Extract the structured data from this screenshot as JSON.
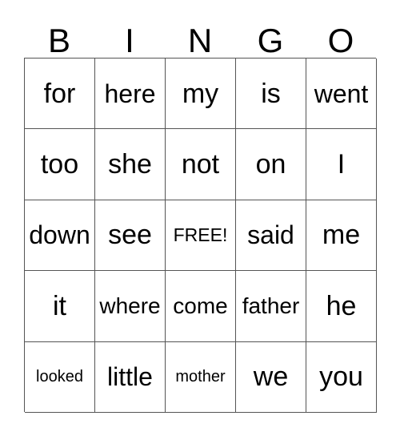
{
  "card": {
    "title_letters": [
      "B",
      "I",
      "N",
      "G",
      "O"
    ],
    "background_color": "#ffffff",
    "text_color": "#000000",
    "grid_line_color": "#555555",
    "columns": 5,
    "rows": 5,
    "free_space": "FREE!",
    "grid": [
      [
        {
          "word": "for",
          "size": "xl"
        },
        {
          "word": "here",
          "size": "lg"
        },
        {
          "word": "my",
          "size": "xl"
        },
        {
          "word": "is",
          "size": "xl"
        },
        {
          "word": "went",
          "size": "lg"
        }
      ],
      [
        {
          "word": "too",
          "size": "xl"
        },
        {
          "word": "she",
          "size": "xl"
        },
        {
          "word": "not",
          "size": "xl"
        },
        {
          "word": "on",
          "size": "xl"
        },
        {
          "word": "I",
          "size": "xl"
        }
      ],
      [
        {
          "word": "down",
          "size": "lg"
        },
        {
          "word": "see",
          "size": "xl"
        },
        {
          "word": "FREE!",
          "size": "sm"
        },
        {
          "word": "said",
          "size": "lg"
        },
        {
          "word": "me",
          "size": "xl"
        }
      ],
      [
        {
          "word": "it",
          "size": "xl"
        },
        {
          "word": "where",
          "size": "md"
        },
        {
          "word": "come",
          "size": "md"
        },
        {
          "word": "father",
          "size": "md"
        },
        {
          "word": "he",
          "size": "xl"
        }
      ],
      [
        {
          "word": "looked",
          "size": "xs"
        },
        {
          "word": "little",
          "size": "lg"
        },
        {
          "word": "mother",
          "size": "xs"
        },
        {
          "word": "we",
          "size": "xl"
        },
        {
          "word": "you",
          "size": "xl"
        }
      ]
    ]
  }
}
